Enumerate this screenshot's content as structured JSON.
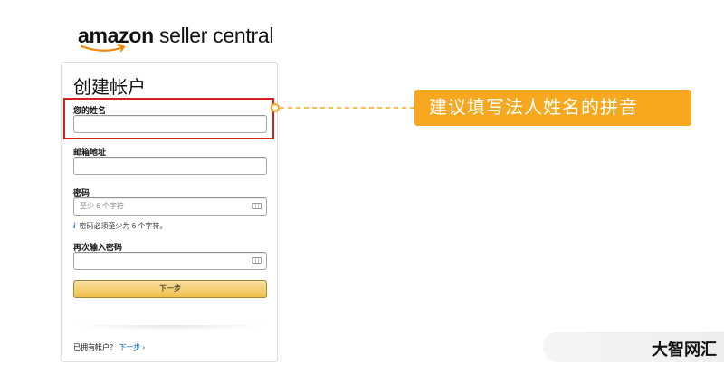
{
  "logo": {
    "brand": "amazon",
    "suffix": "seller central"
  },
  "form": {
    "title": "创建帐户",
    "name_label": "您的姓名",
    "email_label": "邮箱地址",
    "password_label": "密码",
    "password_placeholder": "至少 6 个字符",
    "password_hint": "密码必须至少为 6 个字符。",
    "confirm_label": "再次输入密码",
    "next_button": "下一步",
    "have_account": "已拥有帐户？",
    "next_link": "下一步 ›"
  },
  "callout": {
    "text": "建议填写法人姓名的拼音"
  },
  "watermark": {
    "text": "大智网汇"
  },
  "colors": {
    "highlight": "#d6211f",
    "callout": "#f7a81e",
    "button": "#f0c14b",
    "link": "#0066c0"
  }
}
